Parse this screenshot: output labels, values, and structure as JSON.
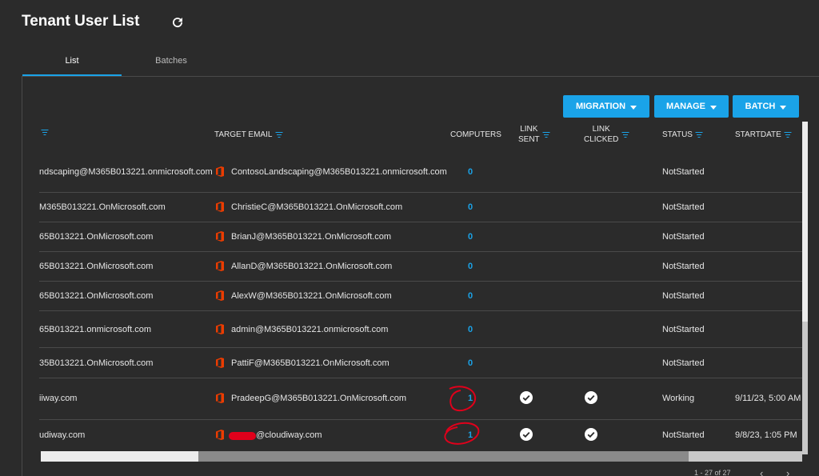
{
  "header": {
    "title": "Tenant User List",
    "refresh_icon": "refresh-icon"
  },
  "tabs": [
    {
      "label": "List",
      "active": true
    },
    {
      "label": "Batches",
      "active": false
    }
  ],
  "actions": {
    "migration": "MIGRATION",
    "manage": "MANAGE",
    "batch": "BATCH"
  },
  "columns": {
    "target_email": "TARGET EMAIL",
    "computers": "COMPUTERS",
    "link_sent": [
      "LINK",
      "SENT"
    ],
    "link_clicked": [
      "LINK",
      "CLICKED"
    ],
    "status": "STATUS",
    "startdate": "STARTDATE"
  },
  "rows": [
    {
      "source": "ndscaping@M365B013221.onmicrosoft.com",
      "target": "ContosoLandscaping@M365B013221.onmicrosoft.com",
      "computers": "0",
      "link_sent": false,
      "link_clicked": false,
      "status": "NotStarted",
      "startdate": ""
    },
    {
      "source": "M365B013221.OnMicrosoft.com",
      "target": "ChristieC@M365B013221.OnMicrosoft.com",
      "computers": "0",
      "link_sent": false,
      "link_clicked": false,
      "status": "NotStarted",
      "startdate": ""
    },
    {
      "source": "65B013221.OnMicrosoft.com",
      "target": "BrianJ@M365B013221.OnMicrosoft.com",
      "computers": "0",
      "link_sent": false,
      "link_clicked": false,
      "status": "NotStarted",
      "startdate": ""
    },
    {
      "source": "65B013221.OnMicrosoft.com",
      "target": "AllanD@M365B013221.OnMicrosoft.com",
      "computers": "0",
      "link_sent": false,
      "link_clicked": false,
      "status": "NotStarted",
      "startdate": ""
    },
    {
      "source": "65B013221.OnMicrosoft.com",
      "target": "AlexW@M365B013221.OnMicrosoft.com",
      "computers": "0",
      "link_sent": false,
      "link_clicked": false,
      "status": "NotStarted",
      "startdate": ""
    },
    {
      "source": "65B013221.onmicrosoft.com",
      "target": "admin@M365B013221.onmicrosoft.com",
      "computers": "0",
      "link_sent": false,
      "link_clicked": false,
      "status": "NotStarted",
      "startdate": ""
    },
    {
      "source": "35B013221.OnMicrosoft.com",
      "target": "PattiF@M365B013221.OnMicrosoft.com",
      "computers": "0",
      "link_sent": false,
      "link_clicked": false,
      "status": "NotStarted",
      "startdate": ""
    },
    {
      "source": "iiway.com",
      "target": "PradeepG@M365B013221.OnMicrosoft.com",
      "computers": "1",
      "link_sent": true,
      "link_clicked": true,
      "status": "Working",
      "startdate": "9/11/23, 5:00 AM"
    },
    {
      "source": "udiway.com",
      "target": "@cloudiway.com",
      "computers": "1",
      "link_sent": true,
      "link_clicked": true,
      "status": "NotStarted",
      "startdate": "9/8/23, 1:05 PM"
    }
  ],
  "pager": {
    "range": "1 - 27 of 27"
  },
  "colors": {
    "accent": "#1aa3e8",
    "office": "#eb3c00",
    "annotation": "#e0001b"
  }
}
